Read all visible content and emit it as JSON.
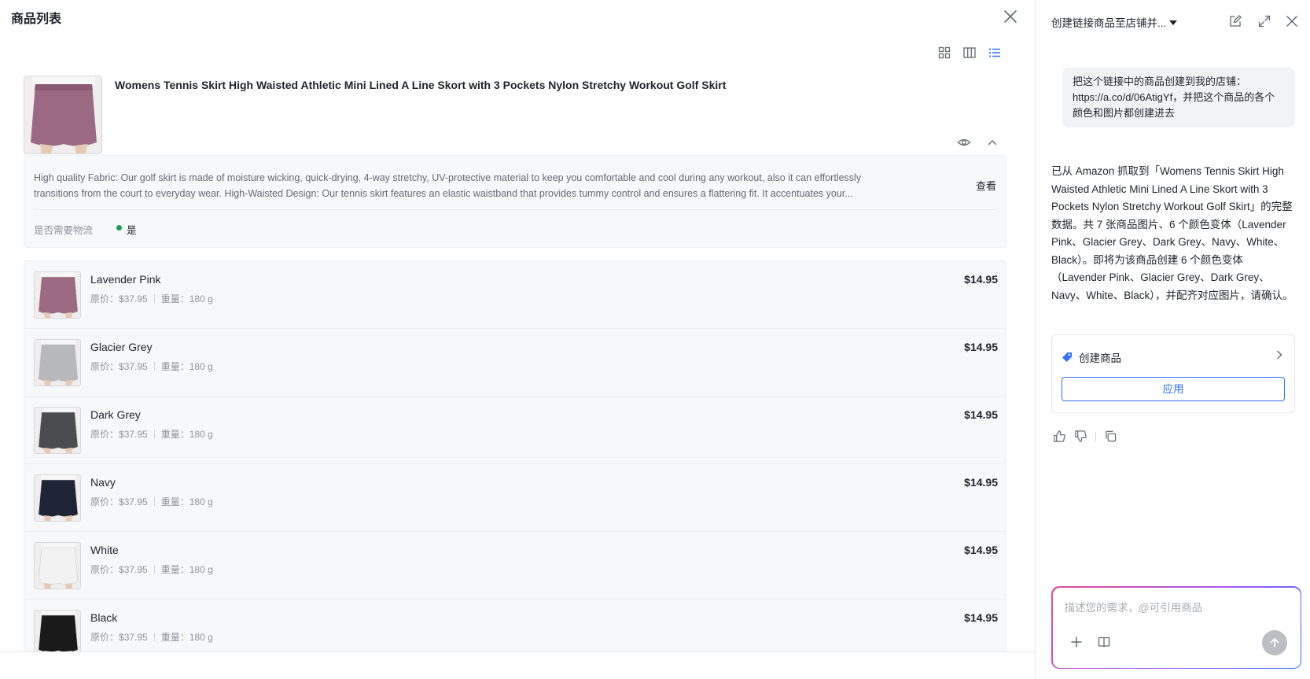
{
  "left": {
    "title": "商品列表",
    "product": {
      "title": "Womens Tennis Skirt High Waisted Athletic Mini Lined A Line Skort with 3 Pockets Nylon Stretchy Workout Golf Skirt",
      "description": "High quality Fabric: Our golf skirt is made of moisture wicking, quick-drying, 4-way stretchy, UV-protective material to keep you comfortable and cool during any workout, also it can effortlessly transitions from the court to everyday wear. High-Waisted Design: Our tennis skirt features an elastic waistband that provides tummy control and ensures a flattering fit. It accentuates your...",
      "view_label": "查看",
      "shipping_label": "是否需要物流",
      "shipping_value": "是",
      "shipping_color": "#1a9b5e"
    },
    "variants": [
      {
        "name": "Lavender Pink",
        "orig_label": "原价：",
        "orig_price": "$37.95",
        "weight_label": "重量：",
        "weight": "180 g",
        "price": "$14.95",
        "color": "#9b6a82"
      },
      {
        "name": "Glacier Grey",
        "orig_label": "原价：",
        "orig_price": "$37.95",
        "weight_label": "重量：",
        "weight": "180 g",
        "price": "$14.95",
        "color": "#b8b9bb"
      },
      {
        "name": "Dark Grey",
        "orig_label": "原价：",
        "orig_price": "$37.95",
        "weight_label": "重量：",
        "weight": "180 g",
        "price": "$14.95",
        "color": "#4a4c50"
      },
      {
        "name": "Navy",
        "orig_label": "原价：",
        "orig_price": "$37.95",
        "weight_label": "重量：",
        "weight": "180 g",
        "price": "$14.95",
        "color": "#1e2335"
      },
      {
        "name": "White",
        "orig_label": "原价：",
        "orig_price": "$37.95",
        "weight_label": "重量：",
        "weight": "180 g",
        "price": "$14.95",
        "color": "#f2f2f2"
      },
      {
        "name": "Black",
        "orig_label": "原价：",
        "orig_price": "$37.95",
        "weight_label": "重量：",
        "weight": "180 g",
        "price": "$14.95",
        "color": "#1a1a1a"
      }
    ]
  },
  "right": {
    "title": "创建链接商品至店铺并...",
    "user_message": "把这个链接中的商品创建到我的店铺：https://a.co/d/06AtigYf，并把这个商品的各个颜色和图片都创建进去",
    "bot_message": "已从 Amazon 抓取到「Womens Tennis Skirt High Waisted Athletic Mini Lined A Line Skort with 3 Pockets Nylon Stretchy Workout Golf Skirt」的完整数据。共 7 张商品图片、6 个颜色变体（Lavender Pink、Glacier Grey、Dark Grey、Navy、White、Black）。即将为该商品创建 6 个颜色变体（Lavender Pink、Glacier Grey、Dark Grey、Navy、White、Black），并配齐对应图片，请确认。",
    "action": {
      "title": "创建商品",
      "apply_label": "应用"
    },
    "composer": {
      "placeholder": "描述您的需求，@可引用商品"
    },
    "accent_color": "#3370ff"
  }
}
